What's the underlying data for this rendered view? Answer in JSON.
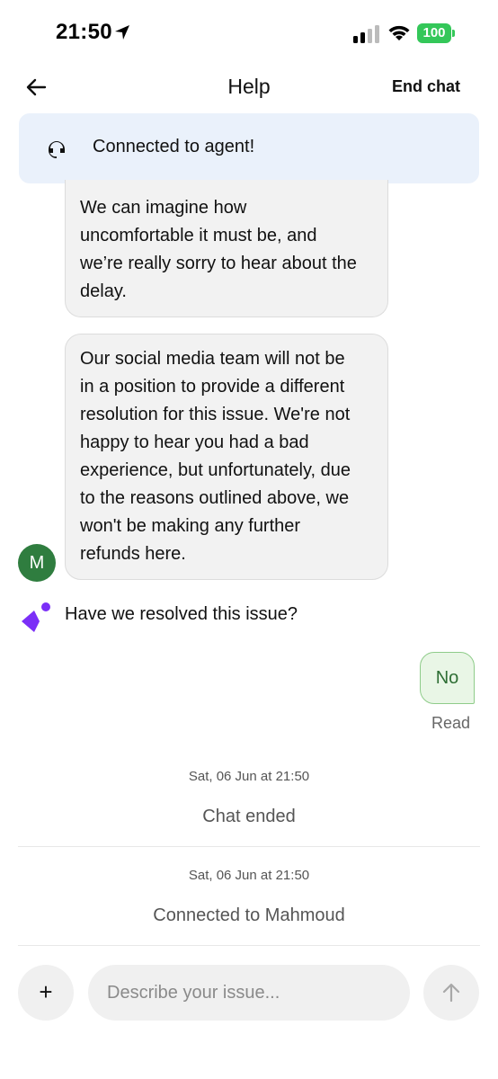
{
  "status_bar": {
    "time": "21:50",
    "battery": "100"
  },
  "header": {
    "title": "Help",
    "end_chat_label": "End chat"
  },
  "banner": {
    "text": "Connected to agent!"
  },
  "messages": {
    "agent_1": [
      "We can imagine how",
      "uncomfortable it must be, and",
      "we’re really sorry to hear about the",
      "delay."
    ],
    "agent_2": [
      "Our social media team will not be",
      "in a position to provide a different",
      "resolution for this issue. We're not",
      "happy to hear you had a bad",
      "experience, but unfortunately, due",
      "to the reasons outlined above, we",
      "won't be making any further",
      "refunds here."
    ],
    "agent_avatar_initial": "M",
    "bot_question": "Have we resolved this issue?",
    "user_reply": "No",
    "read_receipt": "Read"
  },
  "system": {
    "event_1_time": "Sat, 06 Jun at 21:50",
    "event_1_text": "Chat ended",
    "event_2_time": "Sat, 06 Jun at 21:50",
    "event_2_text": "Connected to Mahmoud"
  },
  "composer": {
    "plus_label": "+",
    "placeholder": "Describe your issue..."
  },
  "colors": {
    "banner_bg": "#eaf1fb",
    "avatar": "#2f7d3f",
    "sparkle": "#7b2ff7",
    "reply_bg": "#e9f6e6",
    "battery": "#34c759"
  }
}
